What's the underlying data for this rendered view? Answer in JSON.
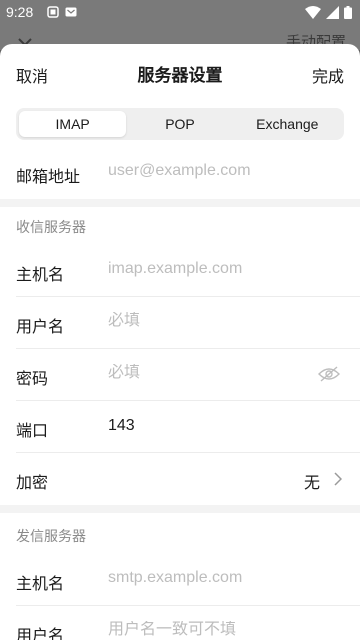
{
  "status": {
    "time": "9:28"
  },
  "behind": {
    "title": "手动配置"
  },
  "header": {
    "cancel": "取消",
    "title": "服务器设置",
    "done": "完成"
  },
  "protocol_tabs": [
    {
      "label": "IMAP",
      "selected": true
    },
    {
      "label": "POP",
      "selected": false
    },
    {
      "label": "Exchange",
      "selected": false
    }
  ],
  "email": {
    "label": "邮箱地址",
    "placeholder": "user@example.com"
  },
  "incoming": {
    "section_title": "收信服务器",
    "host": {
      "label": "主机名",
      "placeholder": "imap.example.com"
    },
    "username": {
      "label": "用户名",
      "placeholder": "必填"
    },
    "password": {
      "label": "密码",
      "placeholder": "必填"
    },
    "port": {
      "label": "端口",
      "value": "143"
    },
    "encryption": {
      "label": "加密",
      "value": "无"
    }
  },
  "outgoing": {
    "section_title": "发信服务器",
    "host": {
      "label": "主机名",
      "placeholder": "smtp.example.com"
    },
    "username": {
      "label": "用户名",
      "placeholder": "用户名一致可不填"
    }
  },
  "icons": {
    "status_left": [
      "notification-icon",
      "app-icon"
    ],
    "status_right": [
      "wifi-icon",
      "signal-icon",
      "battery-icon"
    ],
    "password_toggle": "eye-off-icon",
    "encryption_arrow": "chevron-right-icon"
  }
}
